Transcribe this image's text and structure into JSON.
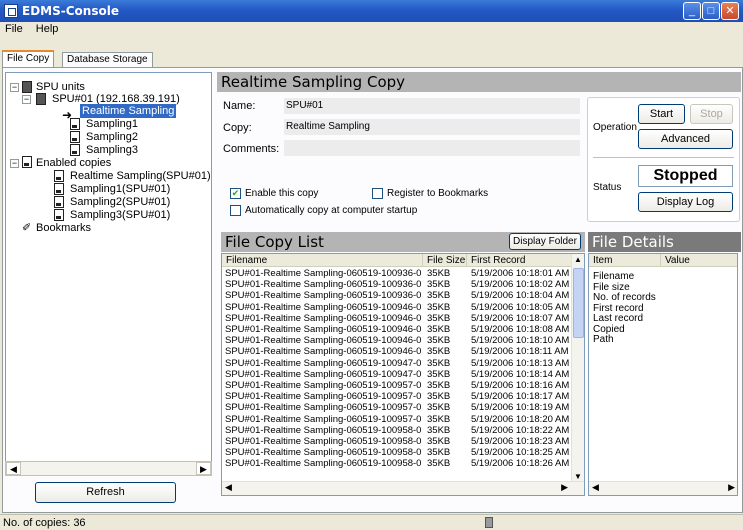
{
  "window": {
    "title": "EDMS-Console"
  },
  "menu": {
    "items": [
      "File",
      "Help"
    ]
  },
  "tabs": [
    "File Copy",
    "Database Storage"
  ],
  "tree": {
    "root": "SPU units",
    "unit": "SPU#01 (192.168.39.191)",
    "unit_children": [
      "Realtime Sampling",
      "Sampling1",
      "Sampling2",
      "Sampling3"
    ],
    "enabled": "Enabled copies",
    "enabled_children": [
      "Realtime Sampling(SPU#01)",
      "Sampling1(SPU#01)",
      "Sampling2(SPU#01)",
      "Sampling3(SPU#01)"
    ],
    "bookmarks": "Bookmarks"
  },
  "refresh_label": "Refresh",
  "copy_panel": {
    "title": "Realtime Sampling Copy",
    "name_label": "Name:",
    "name_value": "SPU#01",
    "copy_label": "Copy:",
    "copy_value": "Realtime Sampling",
    "comments_label": "Comments:",
    "enable_label": "Enable this copy",
    "register_label": "Register to Bookmarks",
    "auto_label": "Automatically copy at computer startup"
  },
  "operation": {
    "label": "Operation",
    "start": "Start",
    "stop": "Stop",
    "advanced": "Advanced",
    "status_label": "Status",
    "status_value": "Stopped",
    "display_log": "Display Log"
  },
  "file_list": {
    "title": "File Copy List",
    "display_folder": "Display Folder",
    "headers": [
      "Filename",
      "File Size",
      "First Record"
    ],
    "rows": [
      [
        "SPU#01-Realtime Sampling-060519-100936-0...",
        "35KB",
        "5/19/2006 10:18:01 AM"
      ],
      [
        "SPU#01-Realtime Sampling-060519-100936-0...",
        "35KB",
        "5/19/2006 10:18:02 AM"
      ],
      [
        "SPU#01-Realtime Sampling-060519-100936-0...",
        "35KB",
        "5/19/2006 10:18:04 AM"
      ],
      [
        "SPU#01-Realtime Sampling-060519-100946-0...",
        "35KB",
        "5/19/2006 10:18:05 AM"
      ],
      [
        "SPU#01-Realtime Sampling-060519-100946-0...",
        "35KB",
        "5/19/2006 10:18:07 AM"
      ],
      [
        "SPU#01-Realtime Sampling-060519-100946-0...",
        "35KB",
        "5/19/2006 10:18:08 AM"
      ],
      [
        "SPU#01-Realtime Sampling-060519-100946-0...",
        "35KB",
        "5/19/2006 10:18:10 AM"
      ],
      [
        "SPU#01-Realtime Sampling-060519-100946-0...",
        "35KB",
        "5/19/2006 10:18:11 AM"
      ],
      [
        "SPU#01-Realtime Sampling-060519-100947-0...",
        "35KB",
        "5/19/2006 10:18:13 AM"
      ],
      [
        "SPU#01-Realtime Sampling-060519-100947-0...",
        "35KB",
        "5/19/2006 10:18:14 AM"
      ],
      [
        "SPU#01-Realtime Sampling-060519-100957-0...",
        "35KB",
        "5/19/2006 10:18:16 AM"
      ],
      [
        "SPU#01-Realtime Sampling-060519-100957-0...",
        "35KB",
        "5/19/2006 10:18:17 AM"
      ],
      [
        "SPU#01-Realtime Sampling-060519-100957-0...",
        "35KB",
        "5/19/2006 10:18:19 AM"
      ],
      [
        "SPU#01-Realtime Sampling-060519-100957-0...",
        "35KB",
        "5/19/2006 10:18:20 AM"
      ],
      [
        "SPU#01-Realtime Sampling-060519-100958-0...",
        "35KB",
        "5/19/2006 10:18:22 AM"
      ],
      [
        "SPU#01-Realtime Sampling-060519-100958-0...",
        "35KB",
        "5/19/2006 10:18:23 AM"
      ],
      [
        "SPU#01-Realtime Sampling-060519-100958-0...",
        "35KB",
        "5/19/2006 10:18:25 AM"
      ],
      [
        "SPU#01-Realtime Sampling-060519-100958-0...",
        "35KB",
        "5/19/2006 10:18:26 AM"
      ]
    ]
  },
  "file_details": {
    "title": "File Details",
    "headers": [
      "Item",
      "Value"
    ],
    "items": [
      "Filename",
      "File size",
      "No. of records",
      "First record",
      "Last record",
      "Copied",
      "Path"
    ]
  },
  "statusbar": {
    "text": "No. of copies: 36"
  }
}
